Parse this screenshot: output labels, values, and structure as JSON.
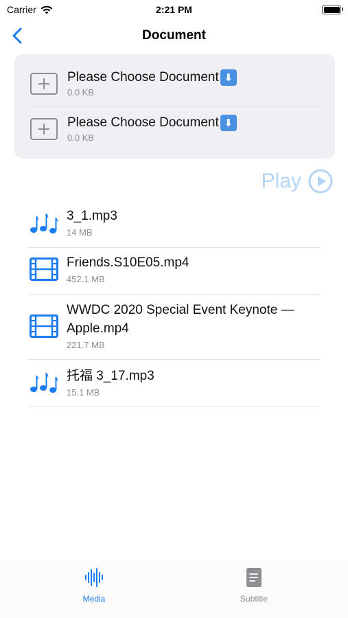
{
  "status_bar": {
    "carrier": "Carrier",
    "time": "2:21 PM"
  },
  "nav": {
    "title": "Document"
  },
  "chooser": [
    {
      "title": "Please Choose Document",
      "emoji": "⬇",
      "size": "0.0 KB"
    },
    {
      "title": "Please Choose Document",
      "emoji": "⬇",
      "size": "0.0 KB"
    }
  ],
  "play": {
    "label": "Play"
  },
  "media_items": [
    {
      "name": "3_1.mp3",
      "size": "14 MB",
      "kind": "music-note-icon"
    },
    {
      "name": "Friends.S10E05.mp4",
      "size": "452.1 MB",
      "kind": "film-icon"
    },
    {
      "name": "WWDC 2020 Special Event Keynote — Apple.mp4",
      "size": "221.7 MB",
      "kind": "film-icon"
    },
    {
      "name": "托福 3_17.mp3",
      "size": "15.1 MB",
      "kind": "music-note-icon"
    }
  ],
  "tabs": [
    {
      "label": "Media",
      "icon": "waveform-icon",
      "selected": true
    },
    {
      "label": "Subtitle",
      "icon": "document-icon",
      "selected": false
    }
  ],
  "colors": {
    "accent": "#1a7cf2",
    "play_disabled": "#b3d4f5",
    "secondary_text": "#8e8e93",
    "card_bg": "#f0f0f4"
  }
}
